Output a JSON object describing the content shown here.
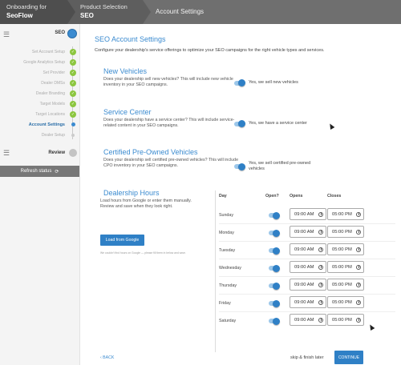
{
  "topbar": {
    "crumb1": {
      "line1": "Onboarding for",
      "line2": "SeoFlow"
    },
    "crumb2": {
      "line1": "Product Selection",
      "line2": "SEO"
    },
    "crumb3": {
      "line1": "Account Settings"
    }
  },
  "sidebar": {
    "logo": "SEO",
    "steps": [
      {
        "label": "Set Account Setup",
        "state": "done"
      },
      {
        "label": "Google Analytics Setup",
        "state": "done"
      },
      {
        "label": "Set Provider",
        "state": "done"
      },
      {
        "label": "Dealer DMSs",
        "state": "done"
      },
      {
        "label": "Dealer Branding",
        "state": "done"
      },
      {
        "label": "Target Models",
        "state": "done"
      },
      {
        "label": "Target Locations",
        "state": "done"
      },
      {
        "label": "Account Settings",
        "state": "active"
      },
      {
        "label": "Dealer Setup",
        "state": "pending"
      }
    ],
    "review_label": "Review",
    "refresh_label": "Refresh status"
  },
  "main": {
    "title": "SEO Account Settings",
    "subtitle": "Configure your dealership's service offerings to optimize your SEO campaigns for the right vehicle types and services.",
    "sections": [
      {
        "heading": "New Vehicles",
        "desc": "Does your dealership sell new vehicles? This will include new vehicle inventory in your SEO campaigns.",
        "option": "Yes, we sell new vehicles"
      },
      {
        "heading": "Service Center",
        "desc": "Does your dealership have a service center? This will include service-related content in your SEO campaigns.",
        "option": "Yes, we have a service center"
      },
      {
        "heading": "Certified Pre-Owned Vehicles",
        "desc": "Does your dealership sell certified pre-owned vehicles? This will include CPO inventory in your SEO campaigns.",
        "option": "Yes, we sell certified pre-owned vehicles"
      }
    ],
    "hours": {
      "heading": "Dealership Hours",
      "desc": "Load hours from Google or enter them manually. Review and save when they look right.",
      "load_button": "Load from Google",
      "note": "We couldn't find hours on Google — please fill them in below and save.",
      "columns": {
        "day": "Day",
        "open_q": "Open?",
        "opens": "Opens",
        "closes": "Closes"
      },
      "days": [
        {
          "day": "Sunday",
          "open": "09:00 AM",
          "close": "05:00 PM"
        },
        {
          "day": "Monday",
          "open": "09:00 AM",
          "close": "05:00 PM"
        },
        {
          "day": "Tuesday",
          "open": "09:00 AM",
          "close": "05:00 PM"
        },
        {
          "day": "Wednesday",
          "open": "09:00 AM",
          "close": "05:00 PM"
        },
        {
          "day": "Thursday",
          "open": "09:00 AM",
          "close": "05:00 PM"
        },
        {
          "day": "Friday",
          "open": "09:00 AM",
          "close": "05:00 PM"
        },
        {
          "day": "Saturday",
          "open": "09:00 AM",
          "close": "05:00 PM"
        }
      ]
    },
    "footer": {
      "back": "‹ BACK",
      "skip": "skip & finish later",
      "continue": "CONTINUE"
    }
  }
}
